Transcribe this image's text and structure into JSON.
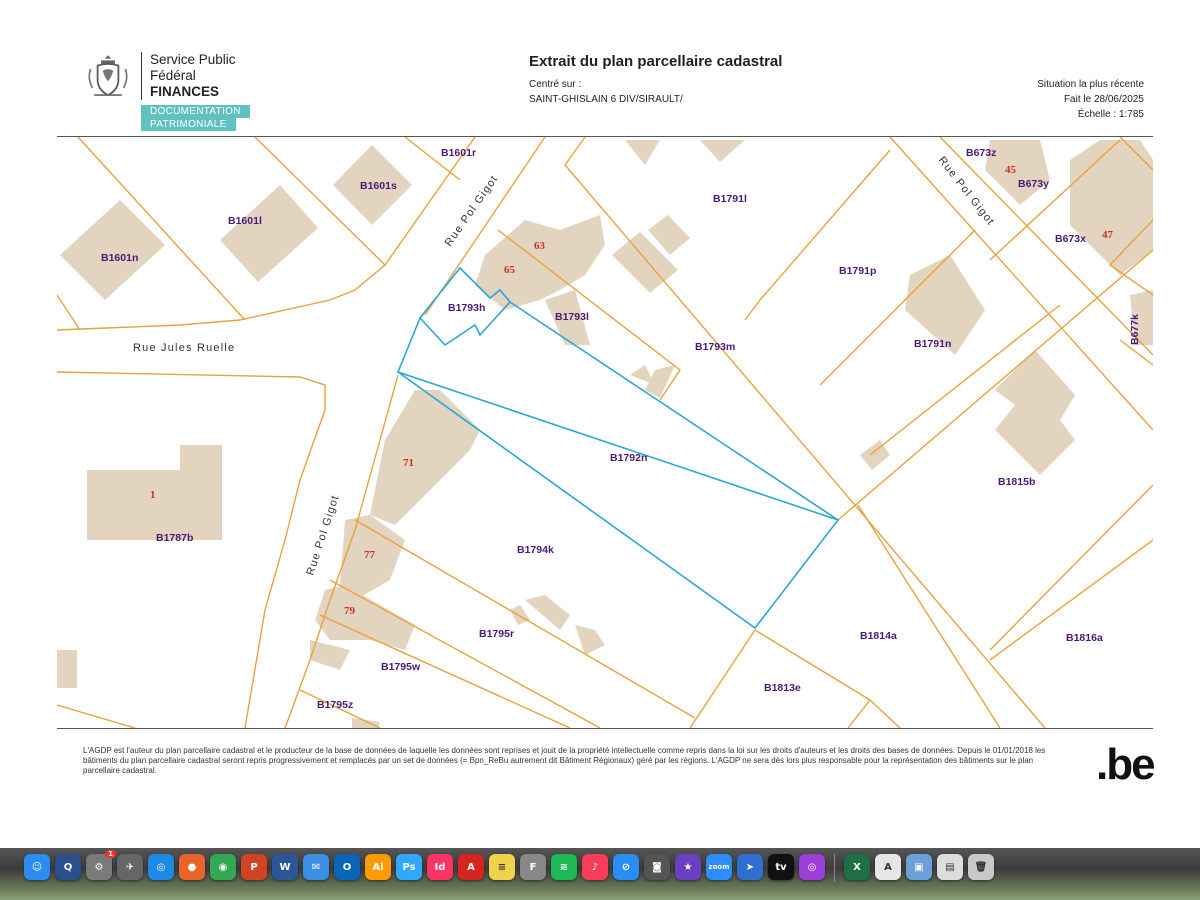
{
  "header": {
    "org_line1": "Service Public",
    "org_line2": "Fédéral",
    "org_line3": "FINANCES",
    "badge_line1": "DOCUMENTATION",
    "badge_line2": "PATRIMONIALE",
    "title": "Extrait du plan parcellaire cadastral",
    "centered_label": "Centré sur :",
    "centered_value": "SAINT-GHISLAIN 6 DIV/SIRAULT/",
    "situation": "Situation la plus récente",
    "date": "Fait le 28/06/2025",
    "scale": "Échelle : 1:785"
  },
  "map": {
    "parcels": [
      "B1601r",
      "B1601s",
      "B1601l",
      "B1601n",
      "B1791l",
      "B673z",
      "B673y",
      "B673x",
      "B1791p",
      "B1793h",
      "B1793l",
      "B1793m",
      "B1791n",
      "B677k",
      "B1792n",
      "B1815b",
      "B1787b",
      "B1794k",
      "B1795r",
      "B1814a",
      "B1816a",
      "B1795w",
      "B1813e",
      "B1795z"
    ],
    "house_numbers": [
      "63",
      "65",
      "45",
      "47",
      "71",
      "1",
      "77",
      "79"
    ],
    "streets": [
      "Rue Pol Gigot",
      "Rue Pol Gigot",
      "Rue Jules Ruelle",
      "Rue Pol Gigot"
    ],
    "colors": {
      "boundary": "#e8a33a",
      "building": "#e3d4bf",
      "highlight": "#2aa6d6",
      "label": "#4b1a78",
      "house_number": "#d03020"
    }
  },
  "footer": {
    "disclaimer": "L'AGDP est l'auteur du plan parcellaire cadastral et le producteur de la base de données de laquelle les données sont reprises et jouit de la propriété intellectuelle comme repris dans la loi sur les droits d'auteurs et les droits des bases de données. Depuis le 01/01/2018 les bâtiments du plan parcellaire cadastral seront repris progressivement et remplacés par un set de données (= Bpn_ReBu autrement dit Bâtiment Régionaux) géré par les régions. L'AGDP ne sera dès lors plus responsable pour la représentation des bâtiments sur le plan parcellaire cadastral.",
    "logo_text": ".be"
  },
  "dock": {
    "apps": [
      {
        "icon": "finder-icon",
        "glyph": "☺",
        "color": "#2d8cf0"
      },
      {
        "icon": "quicktime-icon",
        "glyph": "Q",
        "color": "#2b4f8a"
      },
      {
        "icon": "system-preferences-icon",
        "glyph": "⚙",
        "color": "#7a7a7a",
        "badge": "1"
      },
      {
        "icon": "launchpad-icon",
        "glyph": "✈",
        "color": "#666"
      },
      {
        "icon": "safari-icon",
        "glyph": "◎",
        "color": "#1e88e5"
      },
      {
        "icon": "firefox-icon",
        "glyph": "●",
        "color": "#e8642a"
      },
      {
        "icon": "chrome-icon",
        "glyph": "◉",
        "color": "#34a853"
      },
      {
        "icon": "powerpoint-icon",
        "glyph": "P",
        "color": "#d04423"
      },
      {
        "icon": "word-icon",
        "glyph": "W",
        "color": "#2b579a"
      },
      {
        "icon": "mail-icon",
        "glyph": "✉",
        "color": "#3d8ee6"
      },
      {
        "icon": "outlook-icon",
        "glyph": "O",
        "color": "#0a64b8"
      },
      {
        "icon": "illustrator-icon",
        "glyph": "Ai",
        "color": "#ff9a00"
      },
      {
        "icon": "photoshop-icon",
        "glyph": "Ps",
        "color": "#31a8ff"
      },
      {
        "icon": "indesign-icon",
        "glyph": "Id",
        "color": "#ff3366"
      },
      {
        "icon": "acrobat-icon",
        "glyph": "A",
        "color": "#d4261f"
      },
      {
        "icon": "notes-icon",
        "glyph": "≡",
        "color": "#f2d24a"
      },
      {
        "icon": "font-book-icon",
        "glyph": "F",
        "color": "#888"
      },
      {
        "icon": "spotify-icon",
        "glyph": "≋",
        "color": "#1db954"
      },
      {
        "icon": "music-icon",
        "glyph": "♪",
        "color": "#fa3c5a"
      },
      {
        "icon": "app-store-icon",
        "glyph": "⊘",
        "color": "#2a8cf5"
      },
      {
        "icon": "screenshot-icon",
        "glyph": "◙",
        "color": "#555"
      },
      {
        "icon": "imovie-icon",
        "glyph": "★",
        "color": "#6a3fc0"
      },
      {
        "icon": "zoom-icon",
        "glyph": "zoom",
        "color": "#2d8cff"
      },
      {
        "icon": "transmit-icon",
        "glyph": "➤",
        "color": "#2f6fd0"
      },
      {
        "icon": "apple-tv-icon",
        "glyph": "tv",
        "color": "#111"
      },
      {
        "icon": "podcasts-icon",
        "glyph": "◎",
        "color": "#9c3fd8"
      },
      {
        "icon": "excel-icon",
        "glyph": "X",
        "color": "#1d7044"
      },
      {
        "icon": "textedit-icon",
        "glyph": "A",
        "color": "#e6e6e6"
      },
      {
        "icon": "preview-icon",
        "glyph": "▣",
        "color": "#6aa1d8"
      },
      {
        "icon": "document-icon",
        "glyph": "▤",
        "color": "#ddd"
      },
      {
        "icon": "trash-icon",
        "glyph": "🗑",
        "color": "#c8c8c8"
      }
    ]
  }
}
